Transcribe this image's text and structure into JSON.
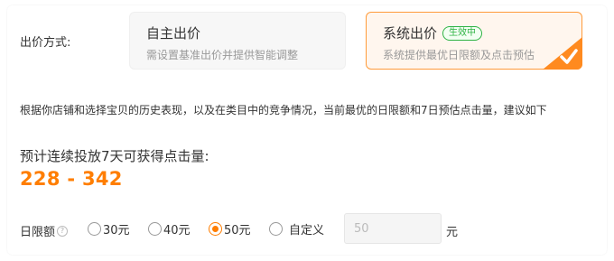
{
  "bid_method": {
    "label": "出价方式:",
    "options": [
      {
        "title": "自主出价",
        "description": "需设置基准出价并提供智能调整"
      },
      {
        "title": "系统出价",
        "badge": "生效中",
        "description": "系统提供最优日限额及点击预估"
      }
    ]
  },
  "suggestion_text": "根据你店铺和选择宝贝的历史表现，以及在类目中的竞争情况，当前最优的日限额和7日预估点击量，建议如下",
  "estimate": {
    "title": "预计连续投放7天可获得点击量:",
    "value": "228 - 342"
  },
  "daily_limit": {
    "label": "日限额",
    "help_icon": "help-circle-icon",
    "options": [
      "30元",
      "40元",
      "50元",
      "自定义"
    ],
    "selected": "50元",
    "custom_placeholder": "50",
    "custom_value": "",
    "unit": "元"
  },
  "colors": {
    "accent": "#ff7e00",
    "active_badge": "#2fb344",
    "selected_card_border": "#ff9b3a"
  }
}
